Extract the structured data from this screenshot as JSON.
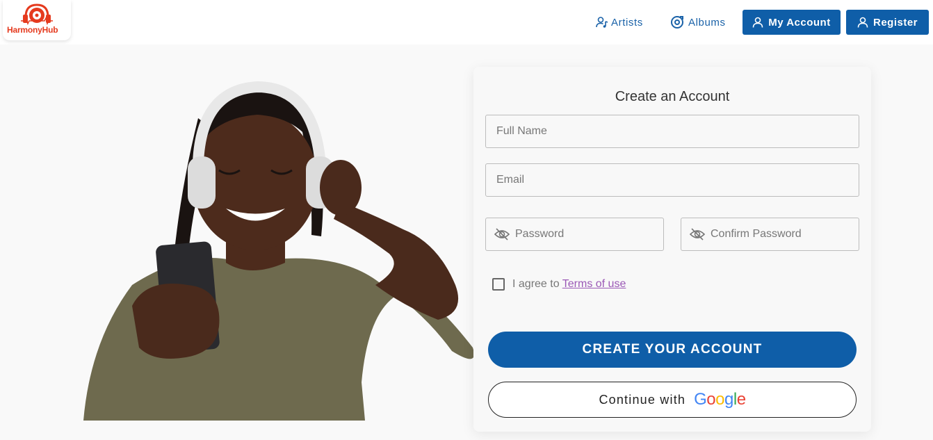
{
  "brand": {
    "name": "HarmonyHub"
  },
  "nav": {
    "artists": "Artists",
    "albums": "Albums",
    "my_account": "My Account",
    "register": "Register"
  },
  "form": {
    "title": "Create an Account",
    "full_name_placeholder": "Full Name",
    "email_placeholder": "Email",
    "password_placeholder": "Password",
    "confirm_password_placeholder": "Confirm Password",
    "agree_text": "I agree to",
    "terms_link": "Terms of use",
    "create_button": "CREATE YOUR ACCOUNT",
    "google_prefix": "Continue with",
    "google_logo": "Google"
  },
  "colors": {
    "primary": "#0f5ea8",
    "brand": "#e53a1e",
    "link": "#9b59b6"
  },
  "icons": {
    "artists": "user-music-icon",
    "albums": "disc-icon",
    "account": "user-icon",
    "password_visibility": "eye-off-icon"
  }
}
